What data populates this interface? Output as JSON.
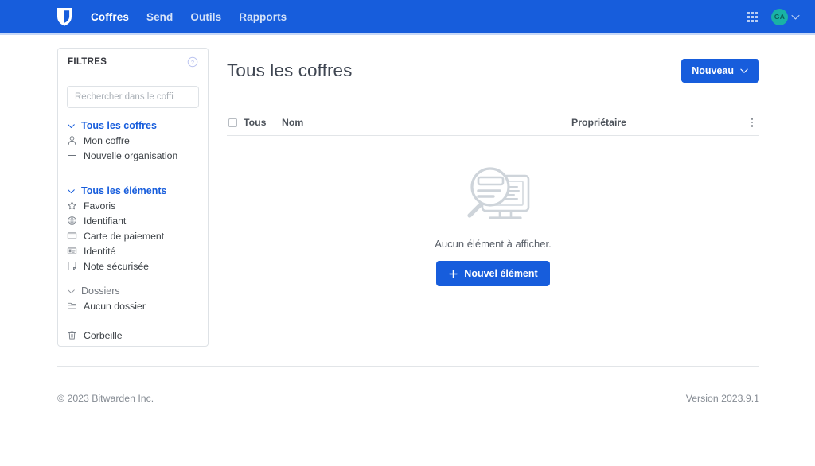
{
  "navbar": {
    "brand_icon": "shield-logo-icon",
    "brand_color": "#175ddc",
    "links": [
      {
        "label": "Coffres",
        "active": true
      },
      {
        "label": "Send",
        "active": false
      },
      {
        "label": "Outils",
        "active": false
      },
      {
        "label": "Rapports",
        "active": false
      }
    ],
    "apps_icon": "apps-grid-icon",
    "account": {
      "initials": "GA",
      "avatar_color": "#19b2a5",
      "chevron_icon": "chevron-down-icon"
    }
  },
  "sidebar": {
    "title": "FILTRES",
    "help_icon": "question-circle-icon",
    "search": {
      "placeholder": "Rechercher dans le coffi",
      "value": "",
      "icon": "search-input"
    },
    "sections": [
      {
        "header": {
          "label": "Tous les coffres",
          "icon": "chevron-down-icon",
          "muted": false
        },
        "items": [
          {
            "label": "Mon coffre",
            "icon": "user-icon"
          },
          {
            "label": "Nouvelle organisation",
            "icon": "plus-icon"
          }
        ]
      },
      {
        "header": {
          "label": "Tous les éléments",
          "icon": "chevron-down-icon",
          "muted": false
        },
        "items": [
          {
            "label": "Favoris",
            "icon": "star-icon"
          },
          {
            "label": "Identifiant",
            "icon": "globe-icon"
          },
          {
            "label": "Carte de paiement",
            "icon": "credit-card-icon"
          },
          {
            "label": "Identité",
            "icon": "id-card-icon"
          },
          {
            "label": "Note sécurisée",
            "icon": "sticky-note-icon"
          }
        ]
      },
      {
        "header": {
          "label": "Dossiers",
          "icon": "chevron-down-icon",
          "muted": true
        },
        "items": [
          {
            "label": "Aucun dossier",
            "icon": "folder-icon"
          }
        ]
      },
      {
        "header": null,
        "items": [
          {
            "label": "Corbeille",
            "icon": "trash-icon"
          }
        ]
      }
    ]
  },
  "main": {
    "title": "Tous les coffres",
    "new_button": {
      "label": "Nouveau",
      "icon": "chevron-down-icon"
    },
    "table": {
      "select_all_checkbox": "select-all-checkbox",
      "columns": [
        "Tous",
        "Nom",
        "Propriétaire"
      ],
      "options_icon": "kebab-menu-icon",
      "rows": []
    },
    "empty_state": {
      "illustration": "search-monitor-illustration",
      "message": "Aucun élément à afficher.",
      "button": {
        "label": "Nouvel élément",
        "icon": "plus-icon"
      }
    }
  },
  "footer": {
    "copyright": "© 2023 Bitwarden Inc.",
    "version": "Version 2023.9.1"
  }
}
